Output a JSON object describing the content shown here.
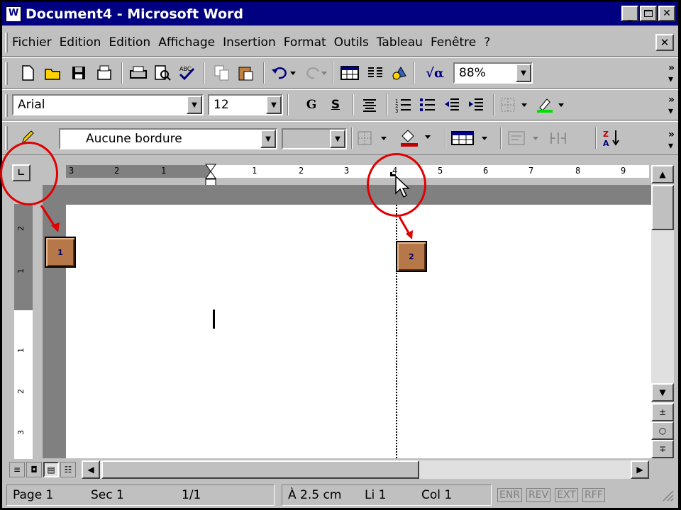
{
  "window": {
    "title": "Document4 - Microsoft Word"
  },
  "menu": [
    "Fichier",
    "Edition",
    "Edition",
    "Affichage",
    "Insertion",
    "Format",
    "Outils",
    "Tableau",
    "Fenêtre",
    "?"
  ],
  "standard_toolbar": {
    "zoom": "88%"
  },
  "format_toolbar": {
    "font": "Arial",
    "size": "12",
    "bold_label": "G",
    "underline_label": "S"
  },
  "tables_toolbar": {
    "border_style": "Aucune bordure"
  },
  "hruler": {
    "labels": [
      "3",
      "2",
      "1",
      "1",
      "2",
      "3",
      "4",
      "5",
      "6",
      "7",
      "8",
      "9"
    ]
  },
  "vruler": {
    "labels": [
      "2",
      "1",
      "1",
      "2",
      "3"
    ]
  },
  "callouts": {
    "one": "1",
    "two": "2"
  },
  "status": {
    "page": "Page 1",
    "sec": "Sec 1",
    "pages": "1/1",
    "at": "À 2.5 cm",
    "line": "Li 1",
    "col": "Col 1",
    "flags": [
      "ENR",
      "REV",
      "EXT",
      "RFF"
    ]
  },
  "colors": {
    "title_bar": "#000080",
    "accent_red": "#e00000",
    "callout_bg": "#b67849"
  }
}
